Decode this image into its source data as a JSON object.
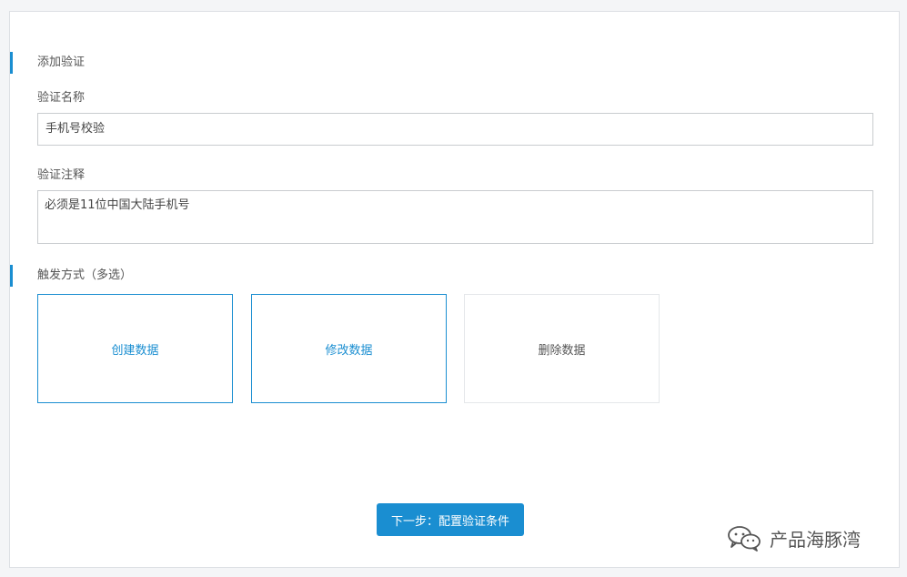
{
  "form": {
    "section_add": "添加验证",
    "name_label": "验证名称",
    "name_value": "手机号校验",
    "note_label": "验证注释",
    "note_value": "必须是11位中国大陆手机号",
    "section_trigger": "触发方式（多选）",
    "triggers": [
      {
        "label": "创建数据",
        "selected": true
      },
      {
        "label": "修改数据",
        "selected": true
      },
      {
        "label": "删除数据",
        "selected": false
      }
    ],
    "next_label": "下一步：配置验证条件"
  },
  "watermark": {
    "text": "产品海豚湾",
    "icon": "wechat-icon"
  },
  "colors": {
    "accent": "#1a8ed1",
    "border": "#c9cccf",
    "background": "#f4f5f7"
  }
}
